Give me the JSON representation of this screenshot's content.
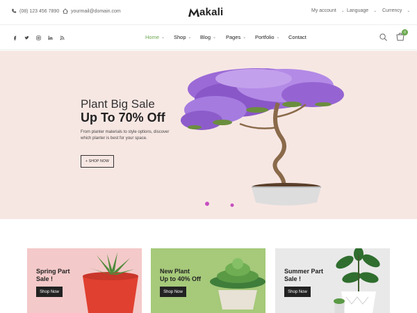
{
  "topbar": {
    "phone": "(08) 123 456 7890",
    "email": "yourmail@domain.com",
    "logo": "akali",
    "my_account": "My account",
    "language": "Language",
    "currency": "Currency"
  },
  "nav": {
    "menu": [
      "Home",
      "Shop",
      "Blog",
      "Pages",
      "Portfolio",
      "Contact"
    ],
    "cart_count": "0"
  },
  "hero": {
    "subtitle": "Plant Big Sale",
    "title": "Up To 70% Off",
    "text": "From planter materials to style options, discover which planter is best for your space.",
    "button": "+ SHOP NOW"
  },
  "banners": [
    {
      "title_line1": "Spring Part",
      "title_line2": "Sale !",
      "button": "Shop Now"
    },
    {
      "title_line1": "New Plant",
      "title_line2": "Up to 40% Off",
      "button": "Shop Now"
    },
    {
      "title_line1": "Summer Part",
      "title_line2": "Sale !",
      "button": "Shop Now"
    }
  ],
  "colors": {
    "accent": "#6aa84f",
    "hero_bg": "#f7e7e3",
    "banner1_bg": "#f4c9c9",
    "banner2_bg": "#a6c97a",
    "banner3_bg": "#e9e9e9"
  }
}
